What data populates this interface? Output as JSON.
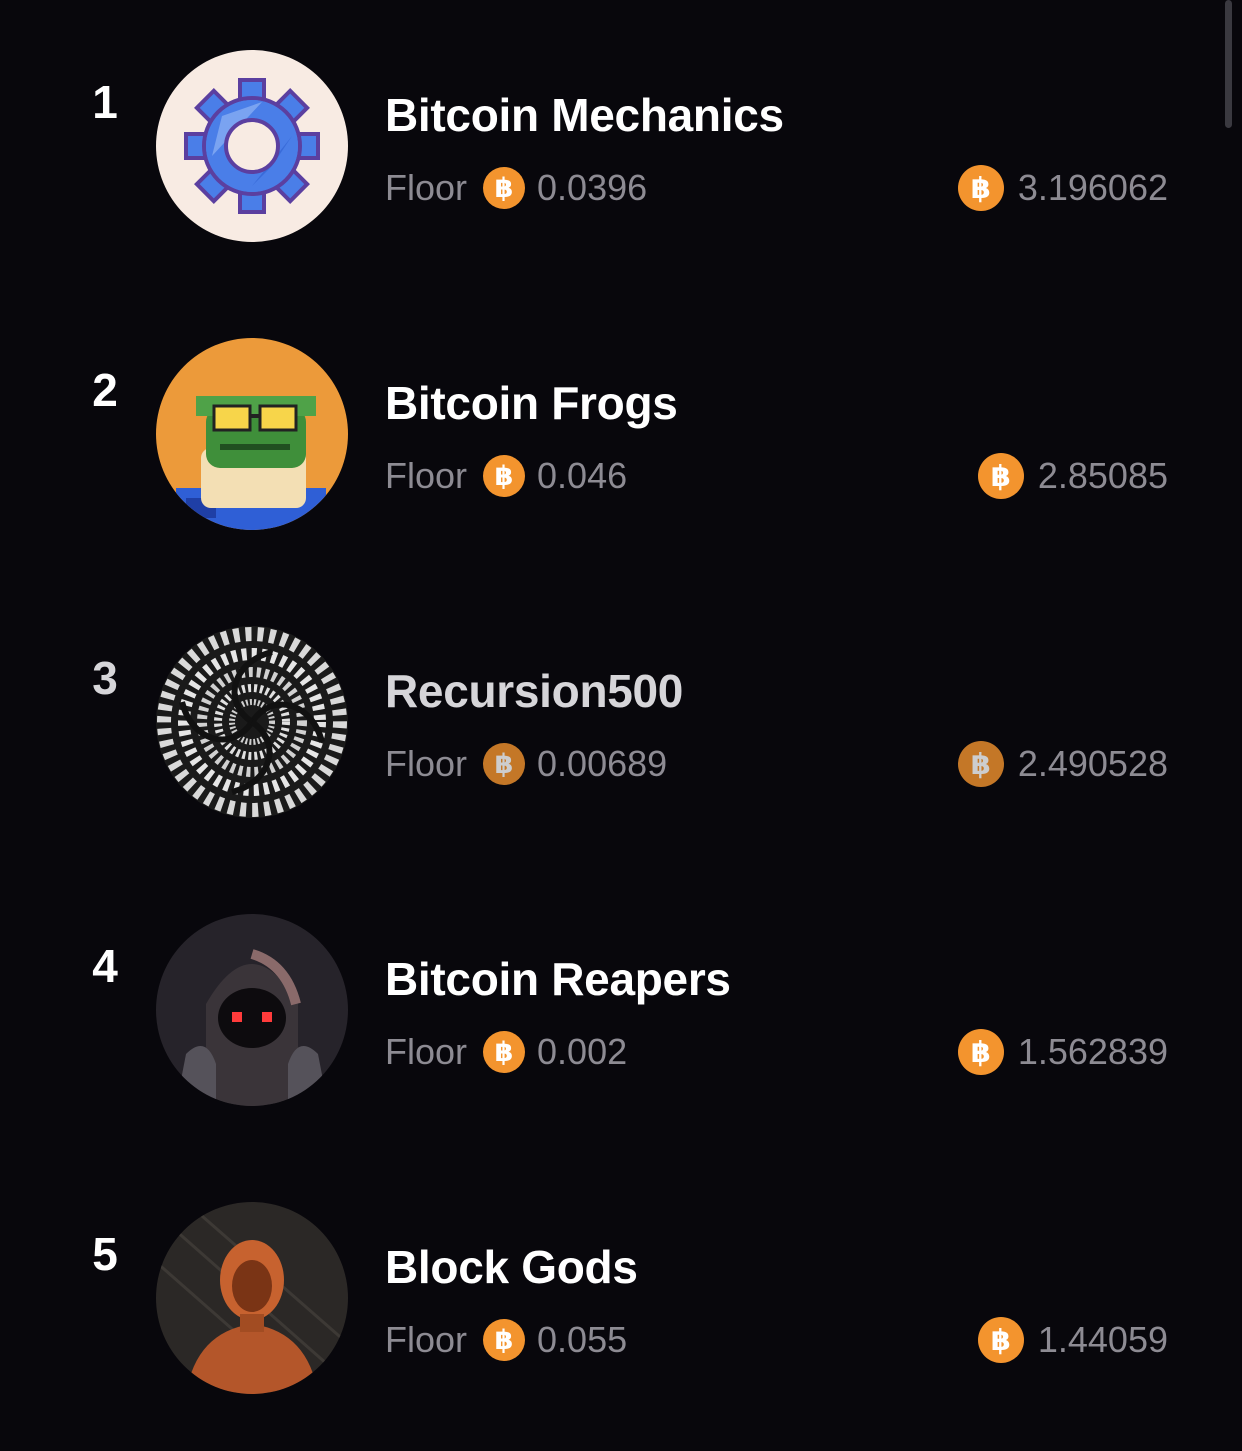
{
  "collections": [
    {
      "rank": "1",
      "name": "Bitcoin Mechanics",
      "floor_label": "Floor",
      "floor": "0.0396",
      "volume": "3.196062",
      "avatar": "gear-icon"
    },
    {
      "rank": "2",
      "name": "Bitcoin Frogs",
      "floor_label": "Floor",
      "floor": "0.046",
      "volume": "2.85085",
      "avatar": "frog-avatar"
    },
    {
      "rank": "3",
      "name": "Recursion500",
      "floor_label": "Floor",
      "floor": "0.00689",
      "volume": "2.490528",
      "avatar": "spiral-avatar"
    },
    {
      "rank": "4",
      "name": "Bitcoin Reapers",
      "floor_label": "Floor",
      "floor": "0.002",
      "volume": "1.562839",
      "avatar": "reaper-avatar"
    },
    {
      "rank": "5",
      "name": "Block Gods",
      "floor_label": "Floor",
      "floor": "0.055",
      "volume": "1.44059",
      "avatar": "figure-avatar"
    }
  ],
  "currency_symbol": "฿",
  "colors": {
    "background": "#08070c",
    "bitcoin_orange": "#f3942e",
    "muted_text": "#8d8b93"
  }
}
